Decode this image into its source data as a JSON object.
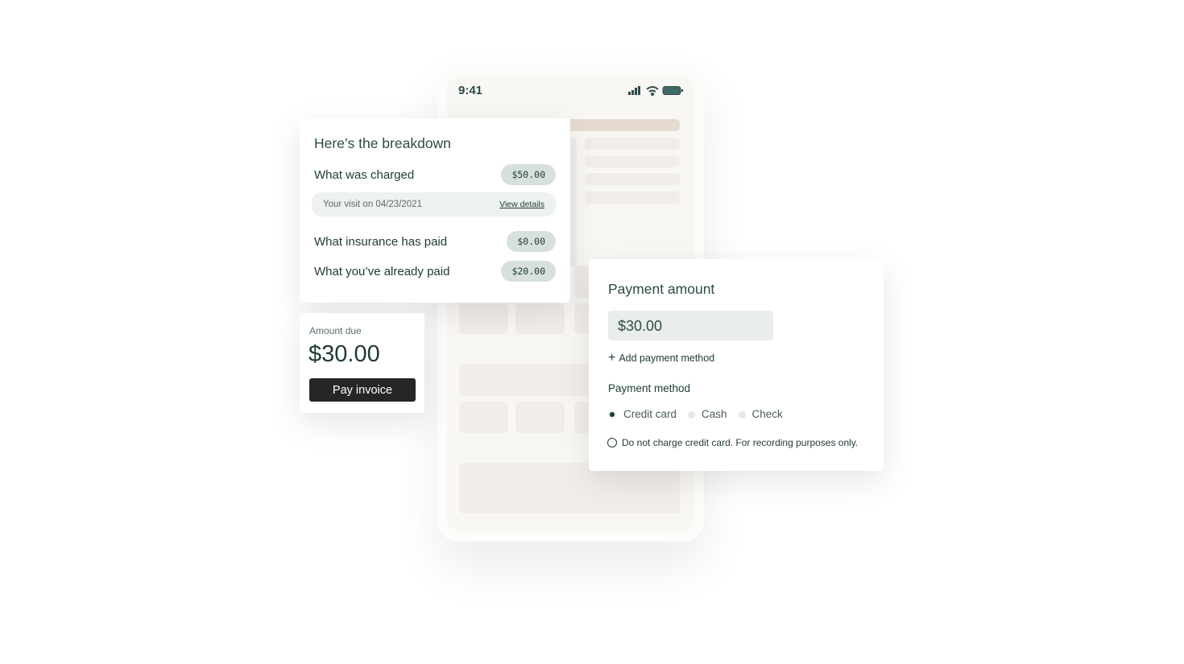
{
  "phone": {
    "time": "9:41",
    "icons": [
      "signal-icon",
      "wifi-icon",
      "battery-icon"
    ]
  },
  "breakdown": {
    "title": "Here’s the breakdown",
    "charged_label": "What was charged",
    "charged_value": "$50.00",
    "visit_text": "Your visit on 04/23/2021",
    "view_details": "View details",
    "insurance_label": "What insurance has paid",
    "insurance_value": "$0.00",
    "paid_label": "What you’ve already paid",
    "paid_value": "$20.00"
  },
  "amount_due": {
    "label": "Amount due",
    "value": "$30.00",
    "button": "Pay invoice"
  },
  "payment": {
    "title": "Payment amount",
    "amount_value": "$30.00",
    "add_method": "Add payment method",
    "method_label": "Payment method",
    "options": [
      {
        "label": "Credit card",
        "selected": true
      },
      {
        "label": "Cash",
        "selected": false
      },
      {
        "label": "Check",
        "selected": false
      }
    ],
    "checkbox_label": "Do not charge credit card. For recording purposes only.",
    "checkbox_checked": false
  },
  "colors": {
    "accent": "#1f3a36",
    "pill": "#d7e0de",
    "placeholder_accent": "#e6dbd0"
  }
}
